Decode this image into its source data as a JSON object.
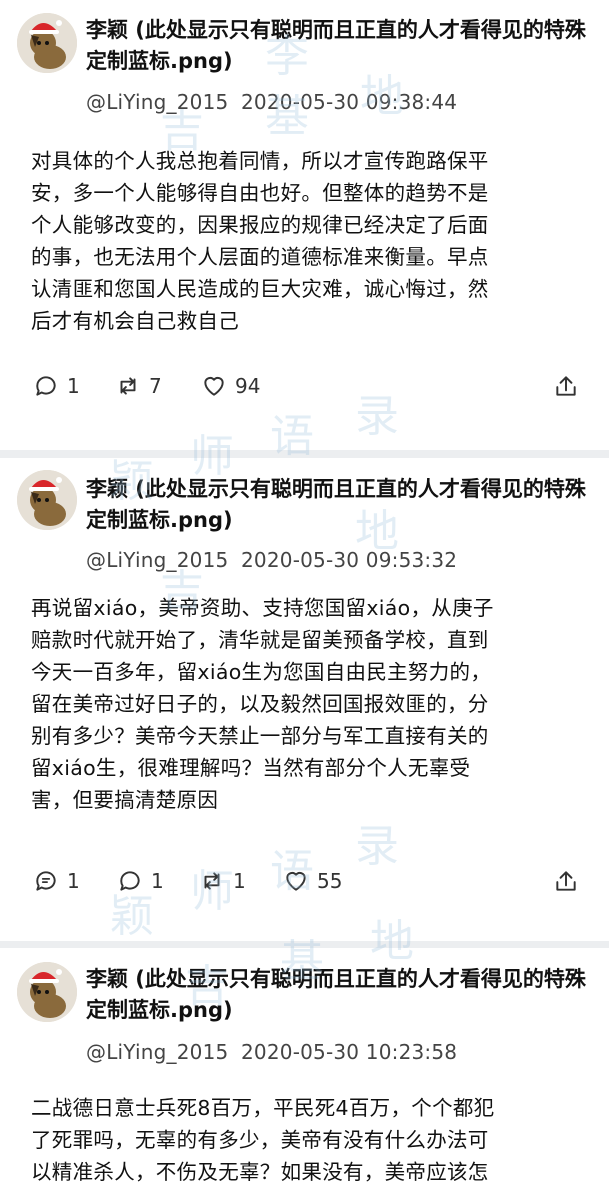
{
  "posts": [
    {
      "name": "李颖 (此处显示只有聪明而且正直的人才看得见的特殊定制蓝标.png)",
      "handle": "@LiYing_2015",
      "timestamp": "2020-05-30 09:38:44",
      "body": "对具体的个人我总抱着同情，所以才宣传跑路保平\n安，多一个人能够得自由也好。但整体的趋势不是\n个人能够改变的，因果报应的规律已经决定了后面\n的事，也无法用个人层面的道德标准来衡量。早点\n认清匪和您国人民造成的巨大灾难，诚心悔过，然\n后才有机会自己救自己",
      "replies": "1",
      "retweets": "7",
      "likes": "94"
    },
    {
      "name": "李颖 (此处显示只有聪明而且正直的人才看得见的特殊定制蓝标.png)",
      "handle": "@LiYing_2015",
      "timestamp": "2020-05-30 09:53:32",
      "body": "再说留xiáo，美帝资助、支持您国留xiáo，从庚子\n赔款时代就开始了，清华就是留美预备学校，直到\n今天一百多年，留xiáo生为您国自由民主努力的，\n留在美帝过好日子的，以及毅然回国报效匪的，分\n别有多少？美帝今天禁止一部分与军工直接有关的\n留xiáo生，很难理解吗？当然有部分个人无辜受\n害，但要搞清楚原因",
      "quotes": "1",
      "replies": "1",
      "retweets": "1",
      "likes": "55"
    },
    {
      "name": "李颖 (此处显示只有聪明而且正直的人才看得见的特殊定制蓝标.png)",
      "handle": "@LiYing_2015",
      "timestamp": "2020-05-30 10:23:58",
      "body": "二战德日意士兵死8百万，平民死4百万，个个都犯\n了死罪吗，无辜的有多少，美帝有没有什么办法可\n以精准杀人，不伤及无辜？如果没有，美帝应该怎"
    }
  ],
  "watermark": {
    "chars": [
      "颖",
      "师",
      "语",
      "录",
      "李",
      "吉",
      "基",
      "地"
    ]
  },
  "colors": {
    "accent": "#1d9bf0",
    "divider": "#eceef0",
    "icon": "#333333"
  },
  "icons": [
    "comment-icon",
    "retweet-icon",
    "heart-icon",
    "share-icon",
    "quote-icon"
  ]
}
